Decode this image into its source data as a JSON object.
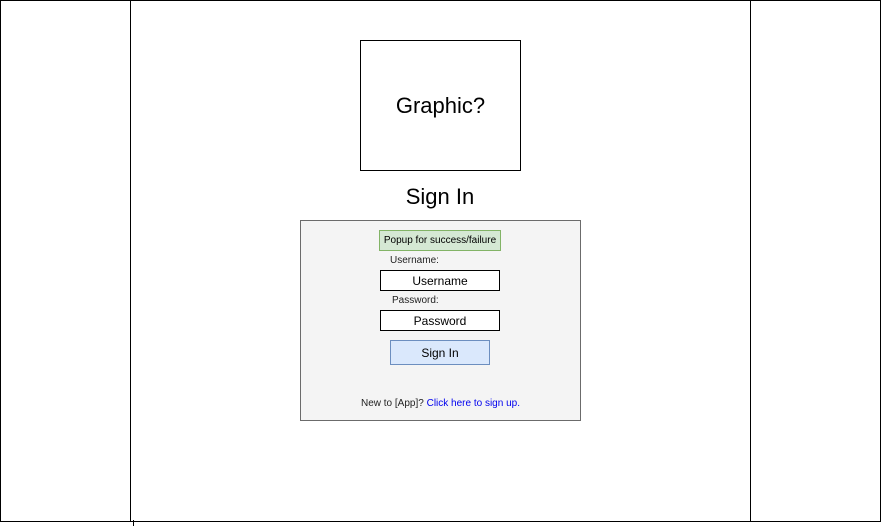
{
  "graphic": {
    "label": "Graphic?"
  },
  "signin": {
    "title": "Sign In",
    "popup_text": "Popup for success/failure",
    "username_label": "Username:",
    "username_placeholder": "Username",
    "password_label": "Password:",
    "password_placeholder": "Password",
    "button_label": "Sign In",
    "signup_prefix": "New to [App]? ",
    "signup_link": "Click here to sign up."
  },
  "colors": {
    "panel_background": "#f4f4f4",
    "popup_fill": "#d5e8d4",
    "popup_border": "#82b366",
    "button_fill": "#dae8fc",
    "button_border": "#6c8ebf",
    "link": "#0000ee"
  }
}
